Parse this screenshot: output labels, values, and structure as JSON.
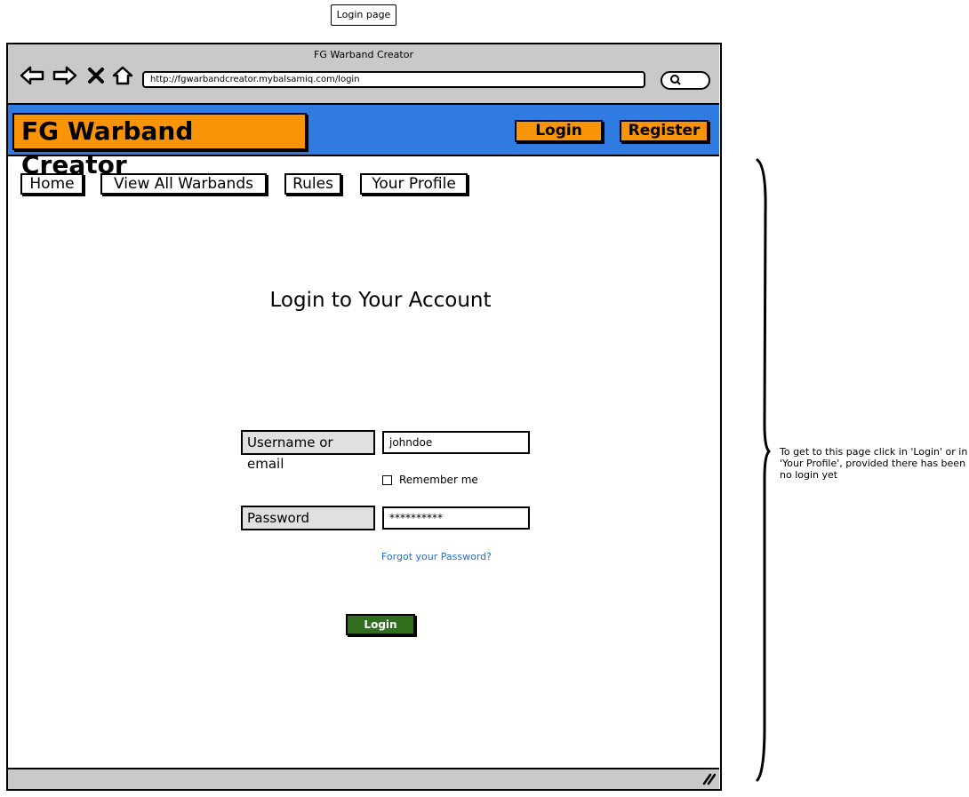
{
  "page_label": "Login page",
  "browser": {
    "title": "FG Warband Creator",
    "url": "http://fgwarbandcreator.mybalsamiq.com/login",
    "nav_icons": [
      "back-arrow-icon",
      "forward-arrow-icon",
      "stop-icon",
      "home-icon"
    ],
    "search_icon": "search-icon"
  },
  "header": {
    "brand": "FG Warband Creator",
    "login_label": "Login",
    "register_label": "Register",
    "bg_color": "#2f7be1",
    "accent_color": "#f89406"
  },
  "nav": {
    "items": [
      "Home",
      "View All Warbands",
      "Rules",
      "Your Profile"
    ]
  },
  "main": {
    "title": "Login to Your Account",
    "username_label": "Username or email",
    "username_value": "johndoe",
    "remember_label": "Remember me",
    "password_label": "Password",
    "password_value": "**********",
    "forgot_link": "Forgot your Password?",
    "login_button": "Login",
    "login_button_color": "#2f6e1d"
  },
  "annotation": {
    "text": "To get to this page click in 'Login' or in 'Your Profile', provided there has been no login yet"
  }
}
